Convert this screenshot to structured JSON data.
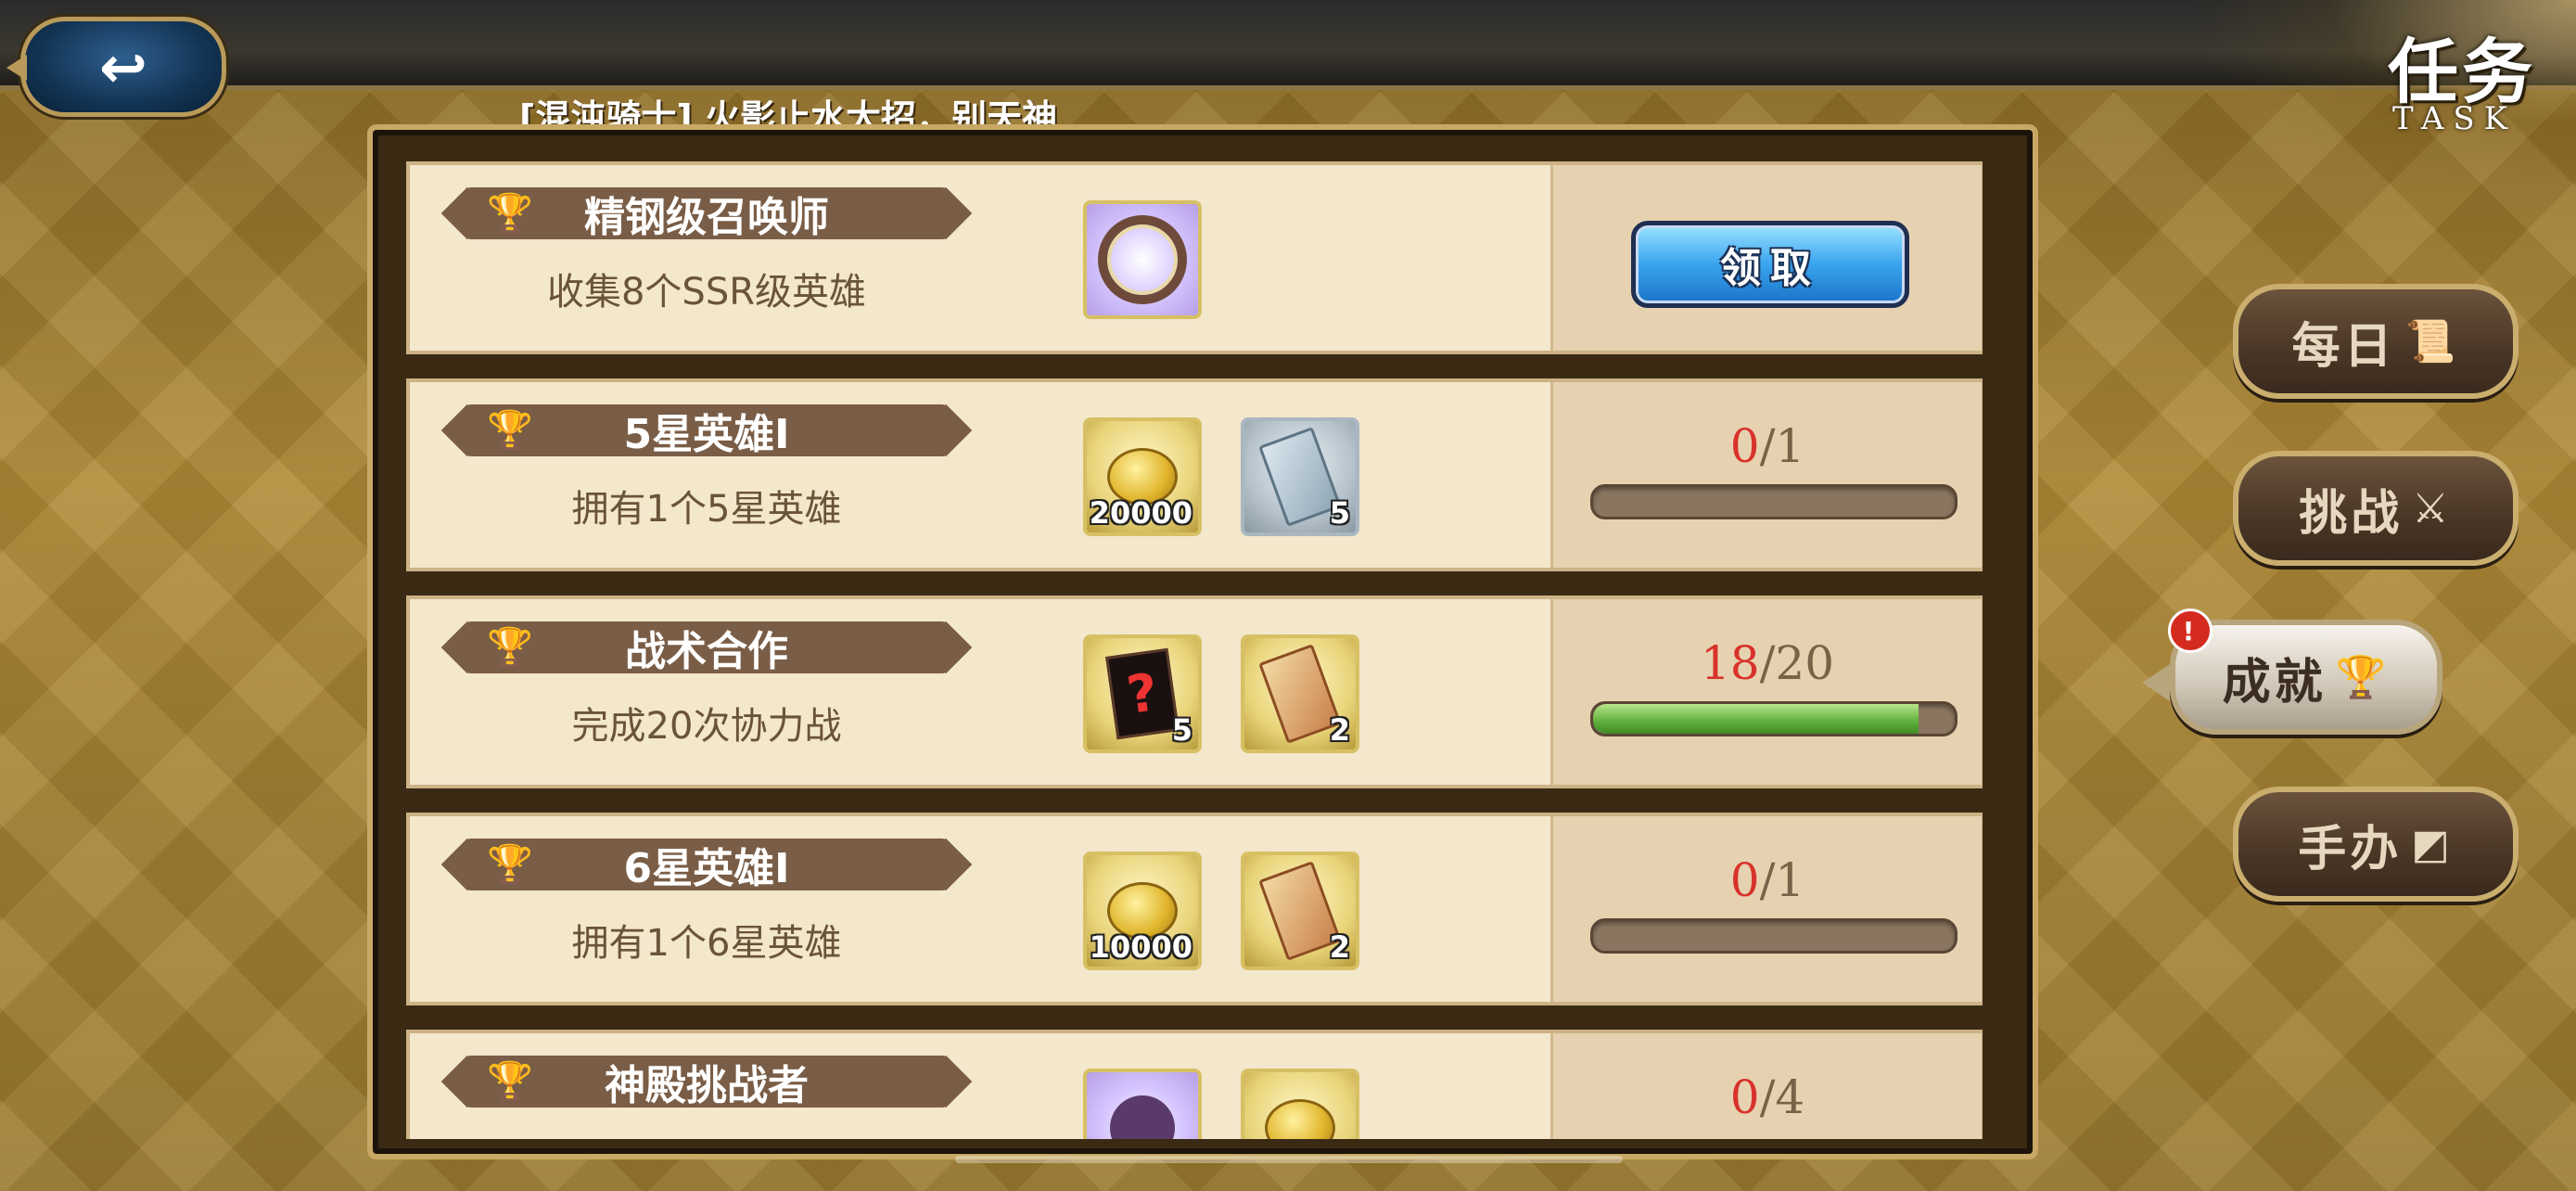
{
  "header": {
    "back_label": "↩",
    "title_cn": "任务",
    "title_en": "TASK"
  },
  "ticker": "[混沌骑士] 火影止水大招，别天神",
  "tasks": [
    {
      "title": "精钢级召唤师",
      "desc": "收集8个SSR级英雄",
      "rewards": [
        {
          "icon": "ring-icon",
          "count": ""
        }
      ],
      "claim_label": "领取",
      "status": "claimable"
    },
    {
      "title": "5星英雄Ⅰ",
      "desc": "拥有1个5星英雄",
      "rewards": [
        {
          "icon": "gold-coin-icon",
          "count": "20000"
        },
        {
          "icon": "silver-ticket-icon",
          "count": "5"
        }
      ],
      "progress": {
        "current": "0",
        "total": "/1",
        "fraction": 0
      }
    },
    {
      "title": "战术合作",
      "desc": "完成20次协力战",
      "rewards": [
        {
          "icon": "mystery-scroll-icon",
          "count": "5"
        },
        {
          "icon": "gold-ticket-icon",
          "count": "2"
        }
      ],
      "progress": {
        "current": "18",
        "total": "/20",
        "fraction": 0.9
      }
    },
    {
      "title": "6星英雄Ⅰ",
      "desc": "拥有1个6星英雄",
      "rewards": [
        {
          "icon": "gold-coin-icon",
          "count": "10000"
        },
        {
          "icon": "gold-ticket-icon",
          "count": "2"
        }
      ],
      "progress": {
        "current": "0",
        "total": "/1",
        "fraction": 0
      }
    },
    {
      "title": "神殿挑战者",
      "desc": "",
      "rewards": [
        {
          "icon": "hero-portrait-icon",
          "count": ""
        },
        {
          "icon": "gold-coin-icon",
          "count": ""
        }
      ],
      "progress": {
        "current": "0",
        "total": "/4",
        "fraction": 0
      }
    }
  ],
  "tabs": [
    {
      "label": "每日",
      "icon": "scroll-icon"
    },
    {
      "label": "挑战",
      "icon": "crossed-swords-icon"
    },
    {
      "label": "成就",
      "icon": "trophy-icon",
      "active": true,
      "badge": "!"
    },
    {
      "label": "手办",
      "icon": "cube-icon"
    }
  ],
  "colors": {
    "accent_red": "#d8322b",
    "progress_green": "#5fae3a",
    "claim_blue": "#3aa4ee"
  }
}
